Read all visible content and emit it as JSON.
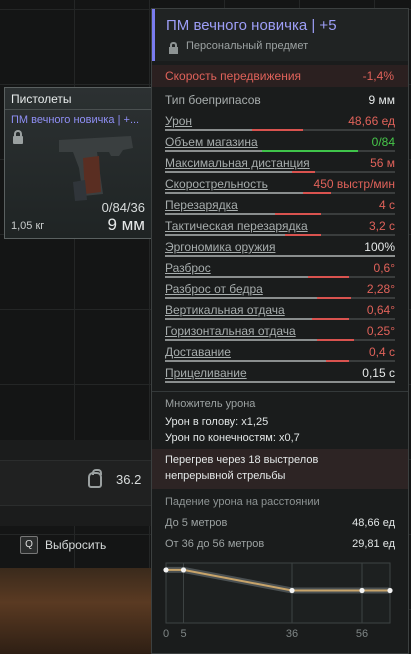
{
  "inventory": {
    "weight_value": "36.2",
    "discard_key": "Q",
    "discard_label": "Выбросить"
  },
  "card": {
    "category": "Пистолеты",
    "name": "ПМ вечного новичка | +...",
    "ammo": "0/84/36",
    "weight": "1,05 кг",
    "caliber": "9 мм"
  },
  "tooltip": {
    "title": "ПМ вечного новичка | +5",
    "subtitle": "Персональный предмет",
    "speed": {
      "label": "Скорость передвижения",
      "value": "-1,4%"
    },
    "stats": [
      {
        "label": "Тип боеприпасов",
        "value": "9 мм",
        "color": "#e6e9e9",
        "underline": false,
        "bar": null
      },
      {
        "label": "Урон",
        "value": "48,66 ед",
        "color": "#e0625a",
        "underline": true,
        "bar": 0.38,
        "delta": 0.22,
        "delta_color": "#d9534f"
      },
      {
        "label": "Объем магазина",
        "value": "0/84",
        "color": "#47c74a",
        "underline": true,
        "bar": 0.42,
        "delta": 0.42,
        "delta_color": "#3fc44a"
      },
      {
        "label": "Максимальная дистанция",
        "value": "56 м",
        "color": "#e0625a",
        "underline": true,
        "bar": 0.55,
        "delta": 0.1,
        "delta_color": "#d9534f"
      },
      {
        "label": "Скорострельность",
        "value": "450 выстр/мин",
        "color": "#e0625a",
        "underline": true,
        "bar": 0.6,
        "delta": 0.12,
        "delta_color": "#d9534f"
      },
      {
        "label": "Перезарядка",
        "value": "4 с",
        "color": "#e0625a",
        "underline": true,
        "bar": 0.48,
        "delta": 0.2,
        "delta_color": "#d9534f"
      },
      {
        "label": "Тактическая перезарядка",
        "value": "3,2 с",
        "color": "#e0625a",
        "underline": true,
        "bar": 0.52,
        "delta": 0.16,
        "delta_color": "#d9534f"
      },
      {
        "label": "Эргономика оружия",
        "value": "100%",
        "color": "#e6e9e9",
        "underline": true,
        "bar": 1.0,
        "delta": 0,
        "delta_color": "#d9534f"
      },
      {
        "label": "Разброс",
        "value": "0,6°",
        "color": "#e0625a",
        "underline": true,
        "bar": 0.62,
        "delta": 0.18,
        "delta_color": "#d9534f"
      },
      {
        "label": "Разброс от бедра",
        "value": "2,28°",
        "color": "#e0625a",
        "underline": true,
        "bar": 0.66,
        "delta": 0.15,
        "delta_color": "#d9534f"
      },
      {
        "label": "Вертикальная отдача",
        "value": "0,64°",
        "color": "#e0625a",
        "underline": true,
        "bar": 0.64,
        "delta": 0.16,
        "delta_color": "#d9534f"
      },
      {
        "label": "Горизонтальная отдача",
        "value": "0,25°",
        "color": "#e0625a",
        "underline": true,
        "bar": 0.66,
        "delta": 0.16,
        "delta_color": "#d9534f"
      },
      {
        "label": "Доставание",
        "value": "0,4 с",
        "color": "#e0625a",
        "underline": true,
        "bar": 0.7,
        "delta": 0.1,
        "delta_color": "#d9534f"
      },
      {
        "label": "Прицеливание",
        "value": "0,15 с",
        "color": "#e6e9e9",
        "underline": true,
        "bar": 1.0,
        "delta": 0,
        "delta_color": "#d9534f"
      }
    ],
    "multiplier": {
      "title": "Множитель урона",
      "head": "Урон в голову: х1,25",
      "limbs": "Урон по конечностям: х0,7"
    },
    "overheat": {
      "line1": "Перегрев через 18 выстрелов",
      "line2": "непрерывной стрельбы"
    },
    "falloff": {
      "title": "Падение урона на расстоянии",
      "rows": [
        {
          "label": "До 5 метров",
          "value": "48,66 ед"
        },
        {
          "label": "От 36 до 56 метров",
          "value": "29,81 ед"
        }
      ]
    }
  },
  "chart_data": {
    "type": "line",
    "x": [
      0,
      5,
      36,
      56,
      64
    ],
    "y": [
      48.66,
      48.66,
      29.81,
      29.81,
      29.81
    ],
    "x_tick_labels": [
      "0",
      "5",
      "36",
      "56"
    ],
    "xlim": [
      0,
      64
    ],
    "line_color": "#c8a46a"
  }
}
